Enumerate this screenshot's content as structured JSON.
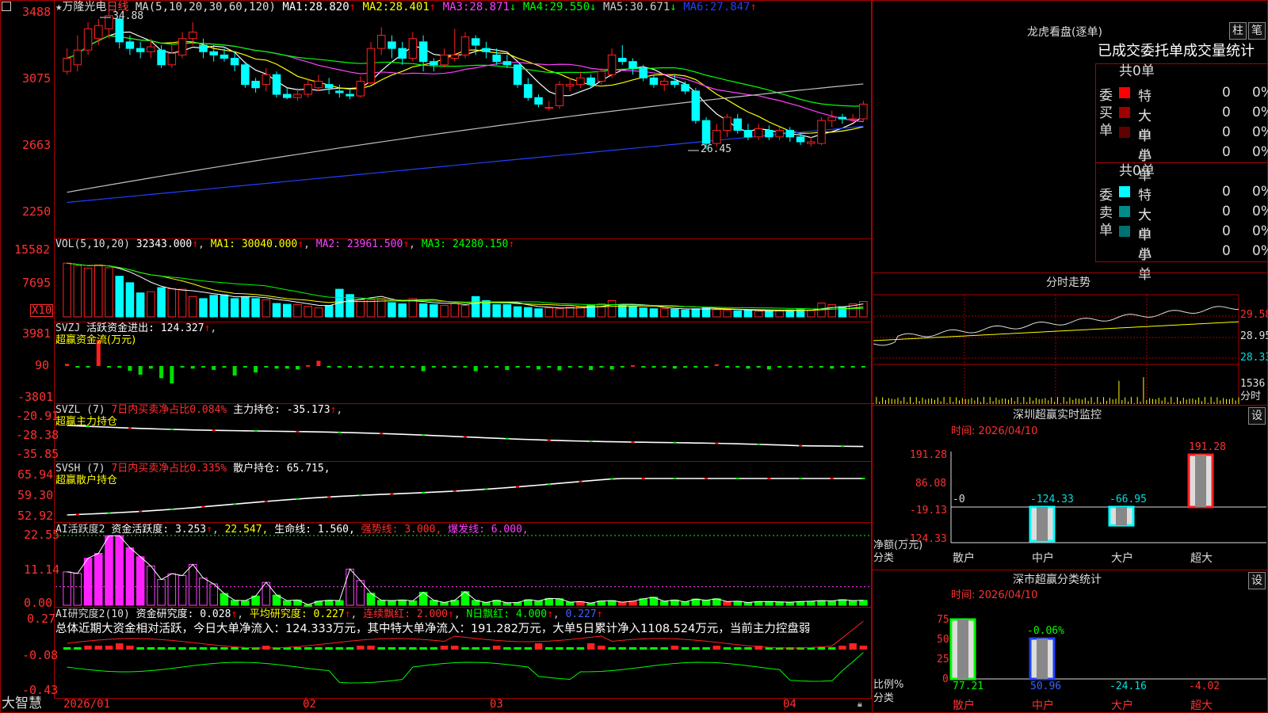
{
  "header": {
    "star": "★",
    "stock_name": "万隆光电",
    "period": "日线",
    "ma_params": "MA(5,10,20,30,60,120)",
    "ma": [
      {
        "label": "MA1:",
        "value": "28.820",
        "arrow": "↑",
        "color": "#ffffff"
      },
      {
        "label": "MA2:",
        "value": "28.401",
        "arrow": "↑",
        "color": "#ffff00"
      },
      {
        "label": "MA3:",
        "value": "28.871",
        "arrow": "↓",
        "color": "#ff40ff"
      },
      {
        "label": "MA4:",
        "value": "29.550",
        "arrow": "↓",
        "color": "#00ff00"
      },
      {
        "label": "MA5:",
        "value": "30.671",
        "arrow": "↓",
        "color": "#c0c0c0"
      },
      {
        "label": "MA6:",
        "value": "27.847",
        "arrow": "↑",
        "color": "#2040ff"
      }
    ]
  },
  "price_axis": [
    "3488",
    "3075",
    "2663",
    "2250"
  ],
  "price_labels": {
    "high": "34.88",
    "low": "26.45"
  },
  "vol": {
    "params": "VOL(5,10,20)",
    "value": "32343.000",
    "ma1": "MA1: 30040.000",
    "ma2": "MA2: 23961.500",
    "ma3": "MA3: 24280.150",
    "axis": [
      "15582",
      "7695"
    ],
    "unit": "X10"
  },
  "svzj": {
    "name": "SVZJ",
    "item": "活跃资金进出: 124.327",
    "sub": "超赢资金流(万元)",
    "axis": [
      "3981",
      "90",
      "-3801"
    ]
  },
  "svzl": {
    "name": "SVZL (7)",
    "ratio": "7日内买卖净占比0.084%",
    "item": "主力持仓: -35.173",
    "sub": "超赢主力持仓",
    "axis": [
      "-20.91",
      "-28.38",
      "-35.85"
    ]
  },
  "svsh": {
    "name": "SVSH (7)",
    "ratio": "7日内买卖净占比0.335%",
    "item": "散户持仓: 65.715,",
    "sub": "超赢散户持仓",
    "axis": [
      "65.94",
      "59.30",
      "52.92"
    ]
  },
  "ai1": {
    "name": "AI活跃度2",
    "i1": "资金活跃度: 3.253",
    "i2": "22.547,",
    "i3": "生命线: 1.560,",
    "i4": "强势线: 3.000,",
    "i5": "爆发线: 6.000,",
    "axis": [
      "22.55",
      "11.14",
      "0.00"
    ]
  },
  "ai2": {
    "name": "AI研究度2(10)",
    "i1": "资金研究度: 0.028",
    "i2": "平均研究度: 0.227",
    "i3": "连续飘红: 2.000",
    "i4": "N日飘红: 4.000",
    "i5": "0.227",
    "summary": "总体近期大资金相对活跃，今日大单净流入：124.333万元，其中特大单净流入：191.282万元，大单5日累计净入1108.524万元，当前主力控盘弱",
    "axis": [
      "0.27",
      "-0.08",
      "-0.43"
    ]
  },
  "date_axis": [
    "2026/01",
    "02",
    "03",
    "04"
  ],
  "brand": "大智慧",
  "right": {
    "lhb_title": "龙虎看盘(逐单)",
    "btn_bar": "柱",
    "btn_pen": "笔",
    "tabs": "已成交委托单成交量统计",
    "buy_side": "委买单",
    "sell_side": "委卖单",
    "buy_total": "共0单",
    "sell_total": "共0单",
    "buy_rows": [
      {
        "label": "特大",
        "count": "0",
        "pct": "0%",
        "color": "#ff0000"
      },
      {
        "label": "大单",
        "count": "0",
        "pct": "0%",
        "color": "#a00000"
      },
      {
        "label": "中单",
        "count": "0",
        "pct": "0%",
        "color": "#600000"
      },
      {
        "label": "小单",
        "count": "0",
        "pct": "0%",
        "color": "#000000"
      }
    ],
    "sell_rows": [
      {
        "label": "特大",
        "count": "0",
        "pct": "0%",
        "color": "#00ffff"
      },
      {
        "label": "大单",
        "count": "0",
        "pct": "0%",
        "color": "#008b8b"
      },
      {
        "label": "中单",
        "count": "0",
        "pct": "0%",
        "color": "#007070"
      },
      {
        "label": "小单",
        "count": "0",
        "pct": "0%",
        "color": "#000000"
      }
    ],
    "intraday_title": "分时走势",
    "intraday_axis": [
      "29.58",
      "28.95",
      "28.33"
    ],
    "intraday_vol": "1536",
    "intraday_unit": "分时",
    "monitor_title": "深圳超赢实时监控",
    "monitor_btn": "设",
    "monitor_time": "时间: 2026/04/10",
    "monitor_axis": [
      "191.28",
      "86.08",
      "-19.13",
      "-124.33"
    ],
    "monitor_side": [
      "净额(万元)",
      "分类"
    ],
    "monitor_cats": [
      "散户",
      "中户",
      "大户",
      "超大"
    ],
    "monitor_vals": [
      "-0",
      "-124.33",
      "-66.95",
      "191.28"
    ],
    "class_title": "深市超赢分类统计",
    "class_btn": "设",
    "class_time": "时间: 2026/04/10",
    "class_axis": [
      "75",
      "50",
      "25",
      "0"
    ],
    "class_side": [
      "比例%",
      "分类"
    ],
    "class_cats": [
      "散户",
      "中户",
      "大户",
      "超大"
    ],
    "class_vals": [
      "77.21",
      "50.96",
      "-24.16",
      "-4.02"
    ],
    "class_extra": "-0.06%"
  },
  "chart_data": {
    "type": "candlestick",
    "candles": [
      [
        31.2,
        32.0,
        32.6,
        31.0
      ],
      [
        31.6,
        32.5,
        33.4,
        31.2
      ],
      [
        32.5,
        33.8,
        34.2,
        32.2
      ],
      [
        33.2,
        34.0,
        34.4,
        32.8
      ],
      [
        33.8,
        34.6,
        34.88,
        33.2
      ],
      [
        34.4,
        33.0,
        34.5,
        32.6
      ],
      [
        33.0,
        32.6,
        33.4,
        32.2
      ],
      [
        32.6,
        32.4,
        33.0,
        32.0
      ],
      [
        32.4,
        32.7,
        33.2,
        32.0
      ],
      [
        32.5,
        31.6,
        32.8,
        31.4
      ],
      [
        31.6,
        32.3,
        32.8,
        31.4
      ],
      [
        32.2,
        33.2,
        33.6,
        32.0
      ],
      [
        33.2,
        33.6,
        34.2,
        32.8
      ],
      [
        32.8,
        32.4,
        33.2,
        32.0
      ],
      [
        32.4,
        32.2,
        32.8,
        31.8
      ],
      [
        32.2,
        32.0,
        32.6,
        31.8
      ],
      [
        32.0,
        31.6,
        32.4,
        31.2
      ],
      [
        31.6,
        30.4,
        31.8,
        30.2
      ],
      [
        30.6,
        30.2,
        30.8,
        29.9
      ],
      [
        30.4,
        31.0,
        31.4,
        30.0
      ],
      [
        31.0,
        29.8,
        31.2,
        29.6
      ],
      [
        29.8,
        29.6,
        30.2,
        29.5
      ],
      [
        29.6,
        29.8,
        30.2,
        29.4
      ],
      [
        29.8,
        30.4,
        30.8,
        29.6
      ],
      [
        30.2,
        30.6,
        31.0,
        30.0
      ],
      [
        30.4,
        30.2,
        30.8,
        29.8
      ],
      [
        30.0,
        29.9,
        30.4,
        29.6
      ],
      [
        29.8,
        29.7,
        30.2,
        29.5
      ],
      [
        29.7,
        30.6,
        30.9,
        29.6
      ],
      [
        30.5,
        32.6,
        33.0,
        30.4
      ],
      [
        32.6,
        33.4,
        33.9,
        32.2
      ],
      [
        33.0,
        32.6,
        33.4,
        32.0
      ],
      [
        32.6,
        32.0,
        33.0,
        31.6
      ],
      [
        32.0,
        33.2,
        33.6,
        31.8
      ],
      [
        33.0,
        31.8,
        33.4,
        31.2
      ],
      [
        31.8,
        31.6,
        32.0,
        31.2
      ],
      [
        31.6,
        32.2,
        32.6,
        31.4
      ],
      [
        32.0,
        32.2,
        33.8,
        31.8
      ],
      [
        32.2,
        33.3,
        33.6,
        32.0
      ],
      [
        33.2,
        32.8,
        33.4,
        32.2
      ],
      [
        32.6,
        32.4,
        33.0,
        32.0
      ],
      [
        32.2,
        31.8,
        32.6,
        31.6
      ],
      [
        31.8,
        31.6,
        32.2,
        31.4
      ],
      [
        31.6,
        30.4,
        31.6,
        30.2
      ],
      [
        30.4,
        29.6,
        30.8,
        29.4
      ],
      [
        29.6,
        29.2,
        29.8,
        29.0
      ],
      [
        29.0,
        29.0,
        29.4,
        28.8
      ],
      [
        29.1,
        30.4,
        30.6,
        28.9
      ],
      [
        30.3,
        30.4,
        30.8,
        30.0
      ],
      [
        30.4,
        30.8,
        31.2,
        30.2
      ],
      [
        30.8,
        30.4,
        31.0,
        30.2
      ],
      [
        30.6,
        31.2,
        31.4,
        30.4
      ],
      [
        31.0,
        32.2,
        32.6,
        30.8
      ],
      [
        32.0,
        31.8,
        32.8,
        31.6
      ],
      [
        31.8,
        31.4,
        32.0,
        31.0
      ],
      [
        31.4,
        30.8,
        31.6,
        30.6
      ],
      [
        30.8,
        30.4,
        31.0,
        30.2
      ],
      [
        30.4,
        30.6,
        30.8,
        30.0
      ],
      [
        30.6,
        30.4,
        31.0,
        30.2
      ],
      [
        30.4,
        30.0,
        30.6,
        29.8
      ],
      [
        30.0,
        28.2,
        30.2,
        28.0
      ],
      [
        28.2,
        26.8,
        28.4,
        26.45
      ],
      [
        26.8,
        27.6,
        28.0,
        26.6
      ],
      [
        27.6,
        28.4,
        28.6,
        27.2
      ],
      [
        28.3,
        27.6,
        28.6,
        27.4
      ],
      [
        27.6,
        27.2,
        28.0,
        27.0
      ],
      [
        27.2,
        27.7,
        28.0,
        27.0
      ],
      [
        27.6,
        27.2,
        27.9,
        27.0
      ],
      [
        27.2,
        27.6,
        27.8,
        27.0
      ],
      [
        27.6,
        27.2,
        27.8,
        26.9
      ],
      [
        27.2,
        26.9,
        27.4,
        26.7
      ],
      [
        26.8,
        26.9,
        27.2,
        26.6
      ],
      [
        26.8,
        28.2,
        28.4,
        26.7
      ],
      [
        28.2,
        28.4,
        28.8,
        27.8
      ],
      [
        28.4,
        28.3,
        28.6,
        28.0
      ],
      [
        28.3,
        28.3,
        28.6,
        28.1
      ],
      [
        28.3,
        29.2,
        29.4,
        28.1
      ]
    ],
    "volumes": [
      13.2,
      12.6,
      12.0,
      12.8,
      12.1,
      10.0,
      8.4,
      5.9,
      6.2,
      7.2,
      6.9,
      6.8,
      5.0,
      4.5,
      5.3,
      5.4,
      4.5,
      5.0,
      4.5,
      4.2,
      3.3,
      3.1,
      3.0,
      2.6,
      2.2,
      2.8,
      6.8,
      5.5,
      4.2,
      4.2,
      4.5,
      3.5,
      3.2,
      4.5,
      3.2,
      3.0,
      2.8,
      3.3,
      2.8,
      5.0,
      4.0,
      3.0,
      3.0,
      2.5,
      2.3,
      2.0,
      2.2,
      2.0,
      2.4,
      2.5,
      2.8,
      3.2,
      4.0,
      3.0,
      2.5,
      2.2,
      2.0,
      2.0,
      1.9,
      1.7,
      2.0,
      2.2,
      1.8,
      1.6,
      1.5,
      1.6,
      1.4,
      1.5,
      1.5,
      1.7,
      1.8,
      1.6,
      3.4,
      3.0,
      2.5,
      3.2,
      3.8
    ],
    "flows": [
      5,
      -1.5,
      -2,
      60,
      -2,
      -4,
      -11,
      -20,
      -6,
      -28,
      -40,
      -2,
      -6,
      -2,
      -9,
      -4,
      -22,
      -2,
      -15,
      -3,
      -6,
      -6,
      -8,
      2,
      12,
      0,
      0,
      -3,
      -4,
      0,
      0,
      -3,
      -2,
      -2,
      -12,
      0,
      -2,
      -4,
      -3,
      -12,
      -2,
      0,
      -9,
      0,
      -3,
      -8,
      0,
      -10,
      -2,
      0,
      -9,
      -2,
      -8,
      0,
      2,
      -2,
      -4,
      0,
      -6,
      -4,
      0,
      -2,
      4,
      0,
      -2,
      -6,
      0,
      -8,
      -2,
      0,
      -2,
      -4,
      0,
      -6,
      0,
      -2,
      0,
      4,
      0,
      -2,
      4,
      0,
      -2,
      -2,
      0
    ],
    "ai_bars": [
      10.8,
      10.3,
      15.2,
      16.8,
      22.5,
      22.5,
      18.6,
      15.7,
      12.7,
      8.3,
      10.2,
      9.6,
      13.2,
      8.8,
      6.9,
      3.8,
      1.6,
      1.5,
      3.0,
      7.4,
      3.3,
      1.5,
      1.7,
      0.2,
      1.3,
      1.6,
      1.5,
      11.7,
      8.0,
      3.9,
      1.6,
      1.5,
      1.7,
      1.4,
      4.2,
      1.6,
      0.9,
      1.6,
      4.4,
      1.6,
      0.9,
      1.6,
      0.8,
      0.9,
      1.8,
      1.4,
      2.2,
      2.1,
      1.0,
      1.2,
      0.7,
      1.4,
      1.5,
      1.0,
      1.3,
      2.1,
      2.6,
      1.3,
      1.7,
      1.1,
      2.0,
      1.6,
      2.1,
      1.2,
      1.3,
      0.9,
      1.2,
      1.2,
      1.1,
      1.0,
      1.2,
      1.3,
      1.5,
      1.4,
      1.8,
      1.5,
      1.6
    ],
    "series": [
      {
        "name": "MA1",
        "color": "#ffffff"
      },
      {
        "name": "MA2",
        "color": "#ffff00"
      },
      {
        "name": "MA3",
        "color": "#ff40ff"
      },
      {
        "name": "MA4",
        "color": "#00ff00"
      },
      {
        "name": "MA5",
        "color": "#c0c0c0"
      },
      {
        "name": "MA6",
        "color": "#2040ff"
      }
    ],
    "ylim": [
      22.5,
      34.88
    ]
  }
}
